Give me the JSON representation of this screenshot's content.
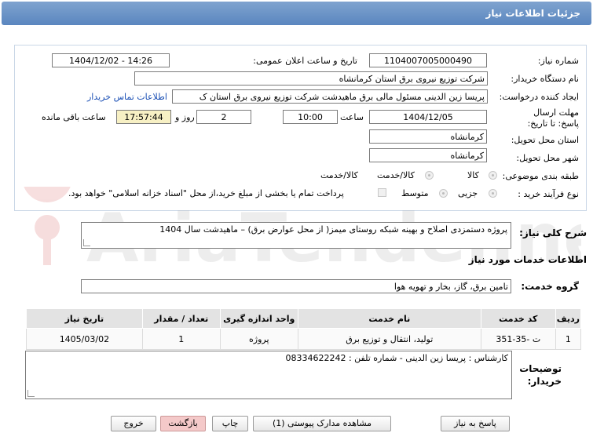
{
  "header": {
    "title": "جزئیات اطلاعات نیاز"
  },
  "fields": {
    "need_number_label": "شماره نیاز:",
    "need_number": "1104007005000490",
    "announce_label": "تاریخ و ساعت اعلان عمومی:",
    "announce_value": "1404/12/02 - 14:26",
    "buyer_org_label": "نام دستگاه خریدار:",
    "buyer_org": "شرکت توزیع نیروی برق استان کرمانشاه",
    "creator_label": "ایجاد کننده درخواست:",
    "creator": "پریسا زین الدینی مسئول مالی برق ماهیدشت شرکت توزیع نیروی برق استان ک",
    "contact_link": "اطلاعات تماس خریدار",
    "deadline_label": "مهلت ارسال پاسخ: تا تاریخ:",
    "deadline_date": "1404/12/05",
    "time_label": "ساعت",
    "deadline_time": "10:00",
    "days_value": "2",
    "days_label": "روز و",
    "remaining_time": "17:57:44",
    "remaining_label": "ساعت باقی مانده",
    "province_label": "استان محل تحویل:",
    "province": "کرمانشاه",
    "city_label": "شهر محل تحویل:",
    "city": "کرمانشاه",
    "category_label": "طبقه بندی موضوعی:",
    "category_options": [
      "کالا",
      "کالا/خدمت"
    ],
    "process_label": "نوع فرآیند خرید :",
    "process_options": [
      "جزیی",
      "متوسط"
    ],
    "payment_note": "پرداخت تمام یا بخشی از مبلغ خرید،از محل \"اسناد خزانه اسلامی\" خواهد بود."
  },
  "summary": {
    "label": "شرح کلی نیاز:",
    "text": "پروژه  دستمزدی اصلاح و بهینه شبکه روستای میمز( از محل عوارض برق) – ماهیدشت  سال 1404"
  },
  "services": {
    "title": "اطلاعات خدمات مورد نیاز",
    "group_label": "گروه خدمت:",
    "group_value": "تامین برق، گاز، بخار و تهویه هوا",
    "columns": [
      "ردیف",
      "کد خدمت",
      "نام خدمت",
      "واحد اندازه گیری",
      "تعداد / مقدار",
      "تاریخ نیاز"
    ],
    "rows": [
      [
        "1",
        "ت -35-351",
        "تولید، انتقال و توزیع برق",
        "پروژه",
        "1",
        "1405/03/02"
      ]
    ]
  },
  "buyer_notes": {
    "label": "توضیحات خریدار:",
    "text": "کارشناس : پریسا زین الدینی - شماره تلفن : 08334622242"
  },
  "buttons": {
    "reply": "پاسخ به نیاز",
    "attachments": "مشاهده مدارک پیوستی (1)",
    "print": "چاپ",
    "back": "بازگشت",
    "exit": "خروج"
  },
  "watermark": {
    "text": "AriaTender.net"
  },
  "colors": {
    "header": "#5a86bf",
    "highlight": "#f7f0c4",
    "link": "#1a4fb5"
  }
}
